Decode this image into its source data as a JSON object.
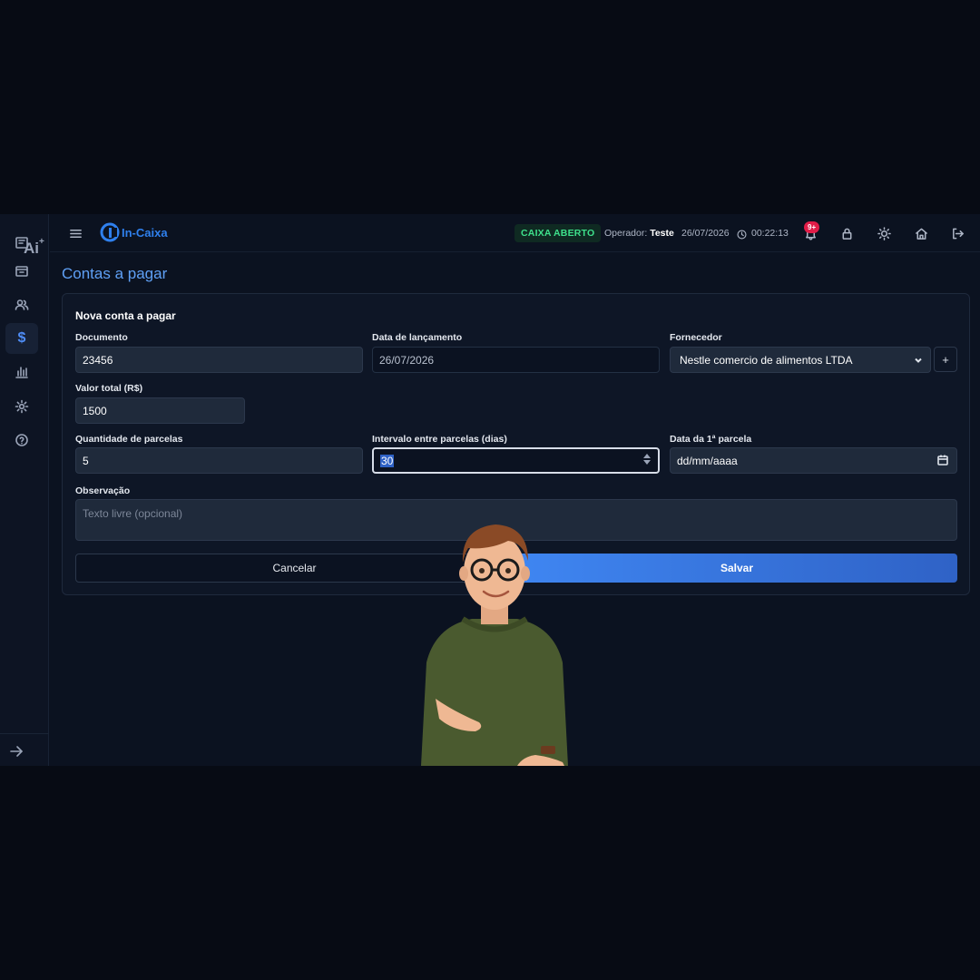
{
  "app": {
    "name": "In-Caixa",
    "ai_label": "Ai"
  },
  "topbar": {
    "status": "CAIXA ABERTO",
    "operator_label": "Operador:",
    "operator_name": "Teste",
    "date": "26/07/2026",
    "time": "00:22:13",
    "notifications": "9+",
    "icons": [
      "menu-icon",
      "bell-icon",
      "lock-icon",
      "sun-icon",
      "home-icon",
      "logout-icon"
    ]
  },
  "sidebar": {
    "items": [
      "register-icon",
      "box-icon",
      "users-icon",
      "dollar-icon",
      "chart-icon",
      "gear-icon",
      "help-icon"
    ],
    "active": "dollar-icon",
    "footer_icon": "arrow-right-icon"
  },
  "page": {
    "title": "Contas a pagar",
    "card_title": "Nova conta a pagar",
    "fields": {
      "documento": {
        "label": "Documento",
        "value": "23456"
      },
      "data_lancamento": {
        "label": "Data de lançamento",
        "value": "26/07/2026"
      },
      "fornecedor": {
        "label": "Fornecedor",
        "value": "Nestle comercio de alimentos LTDA",
        "add_label": "+"
      },
      "valor_total": {
        "label": "Valor total (R$)",
        "value": "1500"
      },
      "quantidade_parcelas": {
        "label": "Quantidade de parcelas",
        "value": "5"
      },
      "intervalo": {
        "label": "Intervalo entre parcelas (dias)",
        "value": "30"
      },
      "data_primeira": {
        "label": "Data da 1ª parcela",
        "placeholder": "dd/mm/aaaa"
      },
      "observacao": {
        "label": "Observação",
        "placeholder": "Texto livre (opcional)"
      }
    },
    "buttons": {
      "cancel": "Cancelar",
      "save": "Salvar"
    }
  },
  "colors": {
    "accent": "#4f8df7",
    "status_green": "#3ee08b",
    "badge_red": "#e11d48",
    "background": "#0b1220"
  }
}
